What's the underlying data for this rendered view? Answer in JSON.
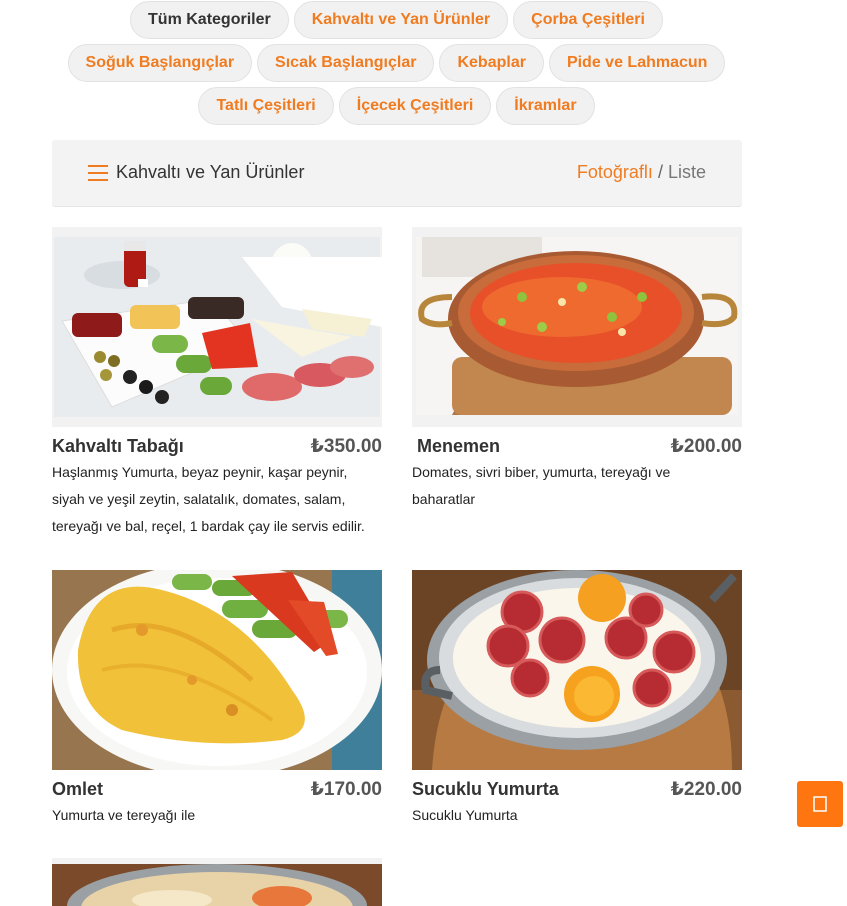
{
  "categories": {
    "row1": [
      {
        "label": "Tüm Kategoriler"
      },
      {
        "label": "Kahvaltı ve Yan Ürünler"
      },
      {
        "label": "Çorba Çeşitleri"
      }
    ],
    "row2": [
      {
        "label": "Soğuk Başlangıçlar"
      },
      {
        "label": "Sıcak Başlangıçlar"
      },
      {
        "label": "Kebaplar"
      },
      {
        "label": "Pide ve Lahmacun"
      }
    ],
    "row3": [
      {
        "label": "Tatlı Çeşitleri"
      },
      {
        "label": "İçecek Çeşitleri"
      },
      {
        "label": "İkramlar"
      }
    ]
  },
  "section": {
    "title": "Kahvaltı ve Yan Ürünler",
    "view_photo": "Fotoğraflı",
    "view_separator": "/",
    "view_list": "Liste"
  },
  "products": [
    {
      "name": "Kahvaltı Tabağı",
      "price": "₺350.00",
      "description": "Haşlanmış Yumurta, beyaz peynir, kaşar peynir, siyah ve yeşil zeytin, salatalık, domates, salam, tereyağı ve bal, reçel, 1 bardak çay ile servis edilir."
    },
    {
      "name": "Menemen",
      "price": "₺200.00",
      "description": "Domates, sivri biber, yumurta, tereyağı ve baharatlar"
    },
    {
      "name": "Omlet",
      "price": "₺170.00",
      "description": "Yumurta ve tereyağı ile"
    },
    {
      "name": "Sucuklu Yumurta",
      "price": "₺220.00",
      "description": "Sucuklu Yumurta"
    }
  ],
  "icons": {
    "menu": "hamburger-menu-icon",
    "fab": "scroll-to-top-icon"
  },
  "colors": {
    "accent": "#f07c21",
    "fab": "#ff7510"
  }
}
